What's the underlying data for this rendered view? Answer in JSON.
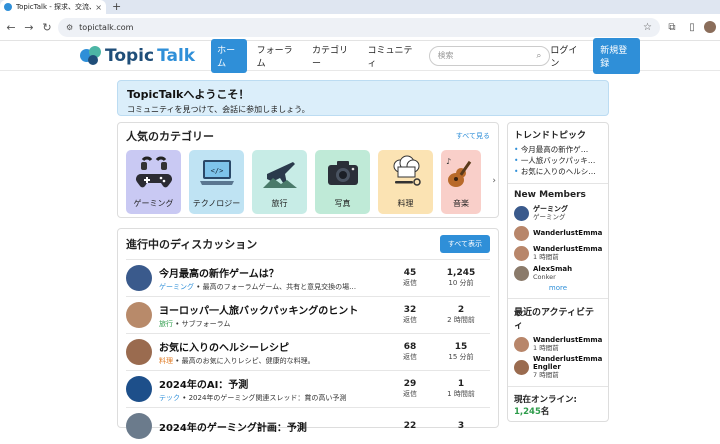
{
  "browser": {
    "tab_title": "TopicTalk - 探求、交流、...",
    "url": "topictalk.com"
  },
  "site": {
    "logo_text_1": "Topic",
    "logo_text_2": "Talk",
    "nav": [
      "ホーム",
      "フォーラム",
      "カテゴリー",
      "コミュニティ"
    ],
    "search_placeholder": "検索",
    "login": "ログイン",
    "signup": "新規登録",
    "accent_color": "#2f8fd8"
  },
  "welcome": {
    "title": "TopicTalkへようこそ！",
    "text": "コミュニティを見つけて、会話に参加しましょう。"
  },
  "categories": {
    "heading": "人気のカテゴリー",
    "see_all": "すべて見る",
    "items": [
      {
        "label": "ゲーミング",
        "icon": "gamepad-icon",
        "bg": "#c9c9f3"
      },
      {
        "label": "テクノロジー",
        "icon": "laptop-icon",
        "bg": "#bfe3f3"
      },
      {
        "label": "旅行",
        "icon": "airplane-icon",
        "bg": "#c7ece6"
      },
      {
        "label": "写真",
        "icon": "camera-icon",
        "bg": "#bfead7"
      },
      {
        "label": "料理",
        "icon": "chef-hat-icon",
        "bg": "#fbe3b3"
      },
      {
        "label": "音楽",
        "icon": "guitar-icon",
        "bg": "#f9cfc9"
      }
    ]
  },
  "discussions": {
    "heading": "進行中のディスカッション",
    "show_all": "すべて表示",
    "rows": [
      {
        "title": "今月最高の新作ゲームは？",
        "category": "ゲーミング",
        "desc": " • 最高のフォーラムゲーム、共有と意見交換の場…",
        "replies": "45",
        "replies_label": "返信",
        "views": "1,245",
        "time": "10 分前",
        "avatar": "#3a5a8c"
      },
      {
        "title": "ヨーロッパ一人旅バックパッキングのヒント",
        "category": "旅行",
        "desc": " • サブフォーラム",
        "replies": "32",
        "replies_label": "返信",
        "views": "2",
        "time": "2 時間前",
        "avatar": "#b88a6a"
      },
      {
        "title": "お気に入りのヘルシーレシピ",
        "category": "料理",
        "desc": " • 最高のお気に入りレシピ、健康的な料理。",
        "replies": "68",
        "replies_label": "返信",
        "views": "15",
        "time": "15 分前",
        "avatar": "#9a6b4f"
      },
      {
        "title": "2024年のAI：予測",
        "category": "テック",
        "desc": " • 2024年のゲーミング関連スレッド：賞の高い予測",
        "replies": "29",
        "replies_label": "返信",
        "views": "1",
        "time": "1 時間前",
        "avatar": "#1d4f8a"
      },
      {
        "title": "2024年のゲーミング計画：予測",
        "category": "",
        "desc": "",
        "replies": "22",
        "replies_label": "",
        "views": "3",
        "time": "",
        "avatar": "#6b7b8c"
      }
    ]
  },
  "sidebar": {
    "trending_heading": "トレンドトピック",
    "trending": [
      "今月最高の新作ゲ…",
      "一人旅バックパッキ…",
      "お気に入りのヘルシ…"
    ],
    "members_heading": "New Members",
    "members": [
      {
        "name": "ゲーミング",
        "sub": "ゲーミング",
        "avatar": "#3a5a8c"
      },
      {
        "name": "WanderlustEmma",
        "sub": "",
        "avatar": "#b8866a"
      },
      {
        "name": "WanderlustEmma",
        "sub": "1 時間前",
        "avatar": "#b8866a"
      },
      {
        "name": "AlexSmah",
        "sub": "Conker",
        "avatar": "#8a7a6a"
      }
    ],
    "more": "more",
    "activity_heading": "最近のアクティビティ",
    "activity": [
      {
        "name": "WanderlustEmma",
        "sub": "1 時間前",
        "avatar": "#b8866a"
      },
      {
        "name": "WanderlustEmma Engller",
        "sub": "7 時間前",
        "avatar": "#9a6b4f"
      }
    ],
    "online_label": "現在オンライン: ",
    "online_count": "1,245",
    "online_suffix": "名"
  }
}
